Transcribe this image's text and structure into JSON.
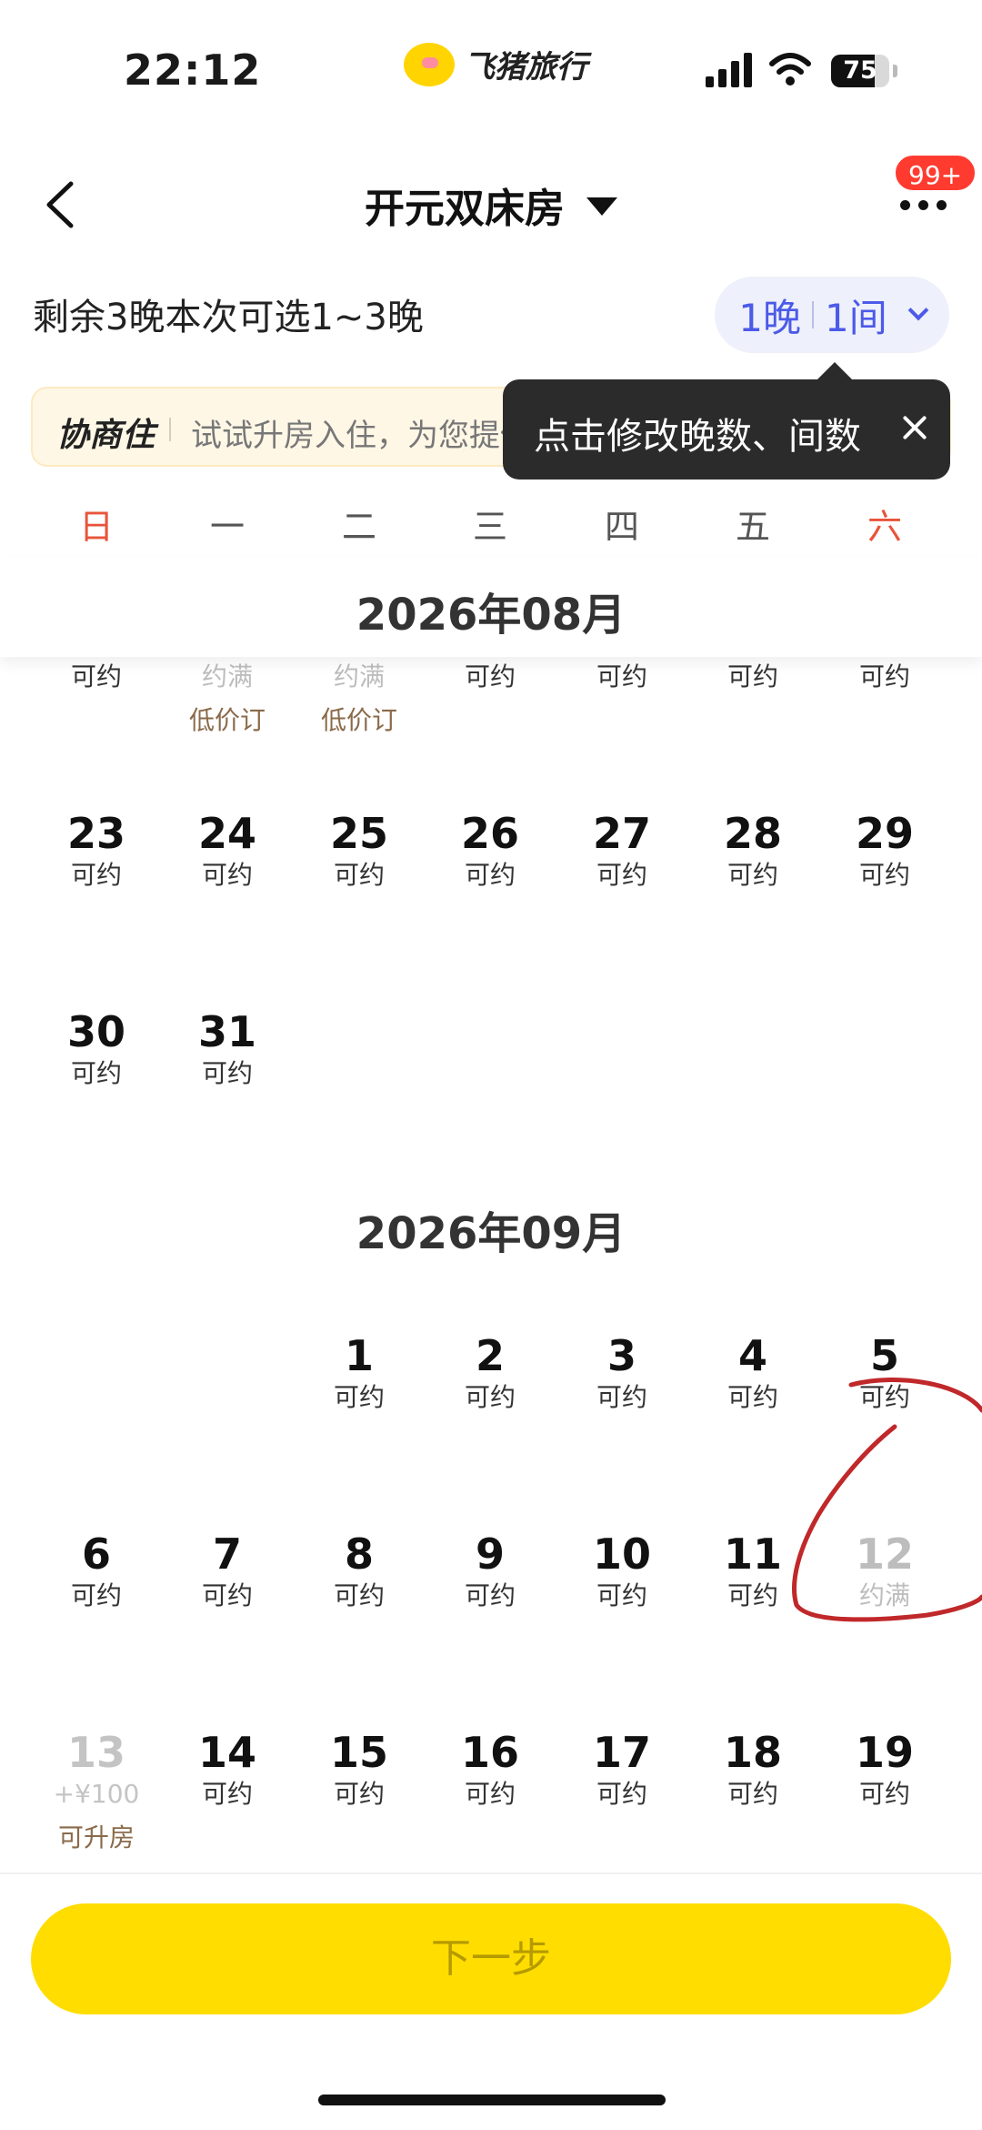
{
  "status_bar": {
    "time": "22:12",
    "brand": "飞猪旅行",
    "battery": "75",
    "battery_level": 0.75
  },
  "header": {
    "title": "开元双床房",
    "badge": "99+"
  },
  "nights": {
    "hint": "剩余3晚本次可选1~3晚",
    "nights_label": "1晚",
    "rooms_label": "1间"
  },
  "promo": {
    "brand": "协商住",
    "text": "试试升房入住，为您提供更多选择"
  },
  "tooltip": {
    "text": "点击修改晚数、间数"
  },
  "weekdays": [
    "日",
    "一",
    "二",
    "三",
    "四",
    "五",
    "六"
  ],
  "calendar": {
    "sticky_month": "2026年08月",
    "august_partial_row": [
      {
        "status": "可约"
      },
      {
        "status": "约满",
        "extra": "低价订",
        "full": true
      },
      {
        "status": "约满",
        "extra": "低价订",
        "full": true
      },
      {
        "status": "可约"
      },
      {
        "status": "可约"
      },
      {
        "status": "可约"
      },
      {
        "status": "可约"
      }
    ],
    "august_rows": [
      [
        {
          "day": "23",
          "status": "可约"
        },
        {
          "day": "24",
          "status": "可约"
        },
        {
          "day": "25",
          "status": "可约"
        },
        {
          "day": "26",
          "status": "可约"
        },
        {
          "day": "27",
          "status": "可约"
        },
        {
          "day": "28",
          "status": "可约"
        },
        {
          "day": "29",
          "status": "可约"
        }
      ],
      [
        {
          "day": "30",
          "status": "可约"
        },
        {
          "day": "31",
          "status": "可约"
        }
      ]
    ],
    "september_label": "2026年09月",
    "september_rows": [
      [
        null,
        null,
        {
          "day": "1",
          "status": "可约"
        },
        {
          "day": "2",
          "status": "可约"
        },
        {
          "day": "3",
          "status": "可约"
        },
        {
          "day": "4",
          "status": "可约"
        },
        {
          "day": "5",
          "status": "可约"
        }
      ],
      [
        {
          "day": "6",
          "status": "可约"
        },
        {
          "day": "7",
          "status": "可约"
        },
        {
          "day": "8",
          "status": "可约"
        },
        {
          "day": "9",
          "status": "可约"
        },
        {
          "day": "10",
          "status": "可约"
        },
        {
          "day": "11",
          "status": "可约"
        },
        {
          "day": "12",
          "status": "约满",
          "full": true
        }
      ],
      [
        {
          "day": "13",
          "status": "+¥100",
          "extra": "可升房",
          "dim": true
        },
        {
          "day": "14",
          "status": "可约"
        },
        {
          "day": "15",
          "status": "可约"
        },
        {
          "day": "16",
          "status": "可约"
        },
        {
          "day": "17",
          "status": "可约"
        },
        {
          "day": "18",
          "status": "可约"
        },
        {
          "day": "19",
          "status": "可约"
        }
      ]
    ]
  },
  "footer": {
    "next_label": "下一步"
  },
  "colors": {
    "accent": "#ffdd00",
    "weekend": "#e8543a",
    "selector": "#4b5ae8",
    "annotation": "#c0282a"
  }
}
